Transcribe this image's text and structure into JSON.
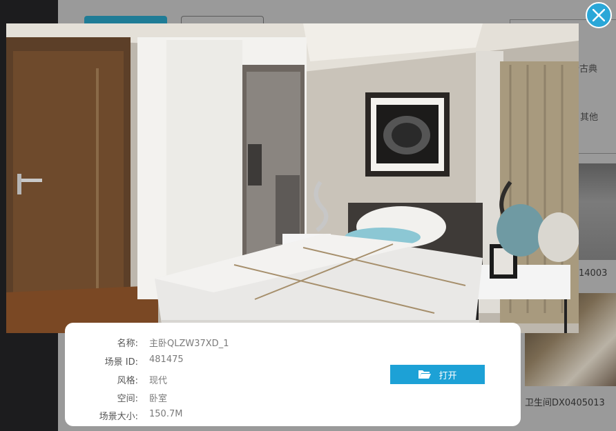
{
  "background": {
    "filter_partial_1": "所古典",
    "filter_partial_2": "其他",
    "thumb_caption_partial": "14003",
    "thumb_caption_2": "卫生间DX0405013"
  },
  "preview": {
    "close_icon": "close-icon"
  },
  "info": {
    "rows": [
      {
        "label": "名称:",
        "value": "主卧QLZW37XD_1"
      },
      {
        "label": "场景 ID:",
        "value": "481475"
      },
      {
        "label": "风格:",
        "value": "现代"
      },
      {
        "label": "空间:",
        "value": "卧室"
      },
      {
        "label": "场景大小:",
        "value": "150.7M"
      }
    ],
    "open_button": {
      "label": "打开",
      "icon": "folder-open-icon"
    }
  },
  "colors": {
    "accent": "#1da1d6",
    "close_bg": "#2aa7d8",
    "overlay": "#7d7d7d"
  }
}
